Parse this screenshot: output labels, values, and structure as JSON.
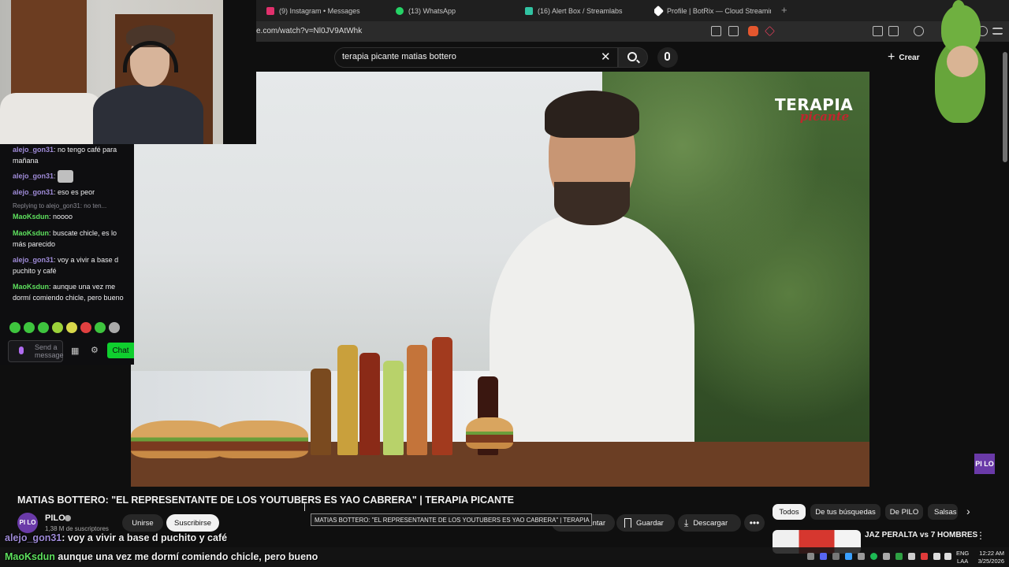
{
  "browser": {
    "tabs": [
      {
        "label": "(9) Instagram • Messages",
        "color": "#e1306c"
      },
      {
        "label": "(13) WhatsApp",
        "color": "#25d366"
      },
      {
        "label": "(16) Alert Box / Streamlabs",
        "color": "#31c3a2"
      },
      {
        "label": "Profile | BotRix — Cloud Streaming B",
        "color": "#ffffff"
      }
    ],
    "new_tab": "+",
    "url": "e.com/watch?v=Nl0JV9AtWhk"
  },
  "header": {
    "search_value": "terapia picante matias bottero",
    "clear": "✕",
    "create_label": "Crear",
    "create_plus": "+"
  },
  "video": {
    "logo_main": "TERAPIA",
    "logo_sub": "picante",
    "watermark": "PI LO",
    "title": "MATIAS BOTTERO: \"EL REPRESENTANTE DE LOS YOUTUBERS ES YAO CABRERA\" | TERAPIA PICANTE",
    "tooltip": "MATIAS BOTTERO: \"EL REPRESENTANTE DE LOS YOUTUBERS ES YAO CABRERA\" | TERAPIA PICANTE"
  },
  "channel": {
    "avatar": "PI LO",
    "name": "PILO",
    "subs": "1,38 M de suscriptores",
    "join_label": "Unirse",
    "subscribe_label": "Suscribirse"
  },
  "actions": {
    "partial_label": "ntar",
    "save_label": "Guardar",
    "download_label": "Descargar",
    "more": "•••"
  },
  "chips": [
    "Todos",
    "De tus búsquedas",
    "De PILO",
    "Salsas"
  ],
  "chips_next": "›",
  "recommendation": {
    "title": "JAZ PERALTA vs 7 HOMBRES",
    "menu": "⋮"
  },
  "chat": {
    "messages": [
      {
        "user": "alejo_gon31",
        "text": "no tengo café para mañana"
      },
      {
        "user": "alejo_gon31",
        "text": ""
      },
      {
        "user": "alejo_gon31",
        "text": "eso es peor"
      },
      {
        "user": "MaoKsdun",
        "text": "noooo"
      },
      {
        "user": "MaoKsdun",
        "text": "buscate chicle, es lo más parecido"
      },
      {
        "user": "alejo_gon31",
        "text": "voy a vivir a base d puchito y café"
      },
      {
        "user": "MaoKsdun",
        "text": "aunque una vez me dormí comiendo chicle, pero bueno"
      }
    ],
    "reply_prefix": "Replying to alejo_gon31: no ten...",
    "input_placeholder": "Send a message",
    "chat_button": "Chat",
    "colors": {
      "user1": "#9f8bd8",
      "user2": "#5ee05e"
    }
  },
  "overlay": {
    "line1_user": "alejo_gon31",
    "line1_text": ": voy a vivir a base d puchito y café",
    "line2_user": "MaoKsdun",
    "line2_text": "aunque una vez me dormí comiendo chicle, pero bueno"
  },
  "taskbar": {
    "lang_top": "ENG",
    "lang_bottom": "LAA",
    "time": "12:22 AM",
    "date": "3/25/2026"
  }
}
